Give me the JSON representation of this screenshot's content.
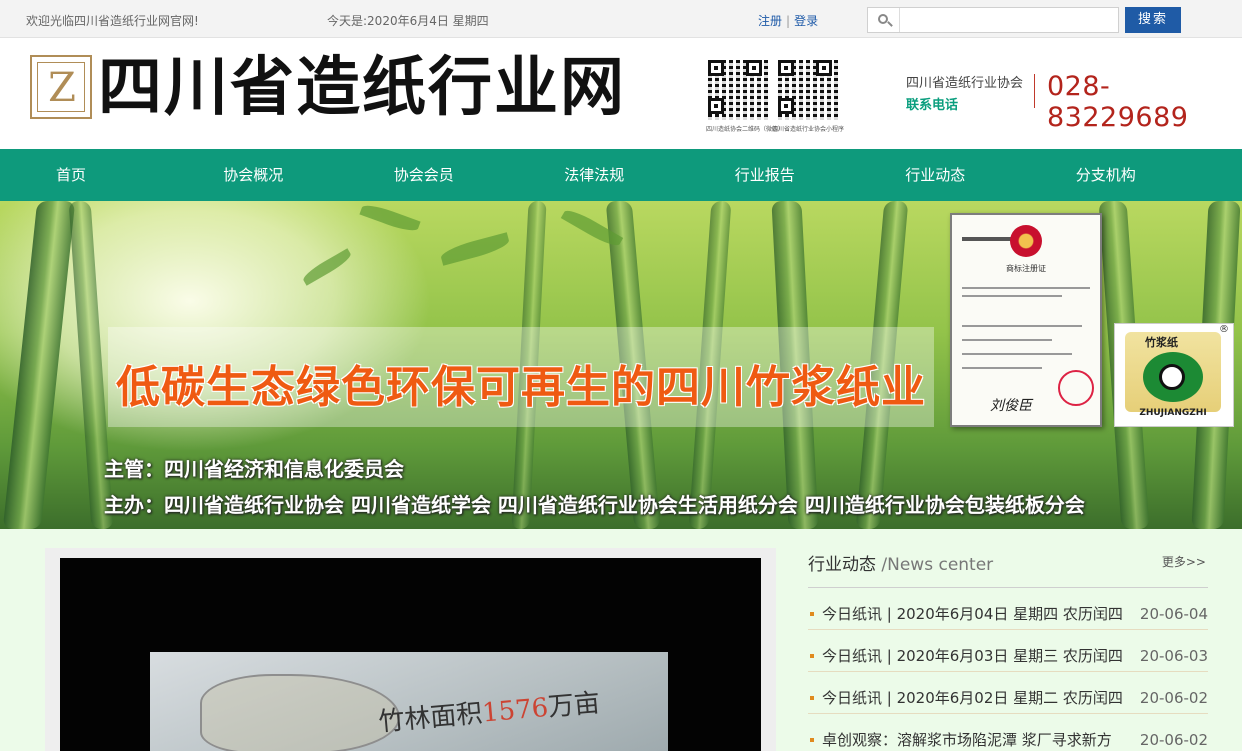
{
  "topbar": {
    "welcome": "欢迎光临四川省造纸行业网官网!",
    "date": "今天是:2020年6月4日 星期四",
    "register": "注册",
    "separator": "|",
    "login": "登录",
    "search_placeholder": "",
    "search_button": "搜索"
  },
  "header": {
    "site_title": "四川省造纸行业网",
    "logo_letter": "Z",
    "qr1_caption": "四川造纸协会二维码（微信）",
    "qr2_caption": "四川省造纸行业协会小程序",
    "association": "四川省造纸行业协会",
    "contact_label": "联系电话",
    "phone": "028-83229689"
  },
  "nav": {
    "items": [
      {
        "label": "首页"
      },
      {
        "label": "协会概况"
      },
      {
        "label": "协会会员"
      },
      {
        "label": "法律法规"
      },
      {
        "label": "行业报告"
      },
      {
        "label": "行业动态"
      },
      {
        "label": "分支机构"
      }
    ]
  },
  "banner": {
    "slogan": "低碳生态绿色环保可再生的四川竹浆纸业",
    "sponsor_line1": "主管：四川省经济和信息化委员会",
    "sponsor_line2": "主办：四川省造纸行业协会 四川省造纸学会 四川省造纸行业协会生活用纸分会 四川造纸行业协会包装纸板分会",
    "certificate_title": "商标注册证",
    "certificate_signature": "刘俊臣",
    "brand_cn": "竹浆纸",
    "brand_en": "ZHUJIANGZHI",
    "brand_reg": "®"
  },
  "video": {
    "overlay_text_prefix": "竹林面积",
    "overlay_number": "1576",
    "overlay_text_suffix": "万亩"
  },
  "news": {
    "title_cn": "行业动态 ",
    "title_en": "/News center",
    "more": "更多>>",
    "items": [
      {
        "title": "今日纸讯 | 2020年6月04日 星期四 农历闰四",
        "date": "20-06-04"
      },
      {
        "title": "今日纸讯 | 2020年6月03日 星期三 农历闰四",
        "date": "20-06-03"
      },
      {
        "title": "今日纸讯 | 2020年6月02日 星期二 农历闰四",
        "date": "20-06-02"
      },
      {
        "title": "卓创观察：溶解浆市场陷泥潭 浆厂寻求新方",
        "date": "20-06-02"
      }
    ]
  },
  "colors": {
    "nav_green": "#0e9a7c",
    "phone_red": "#b3241c",
    "slogan_orange": "#ef5a12",
    "search_blue": "#1f5ba6"
  }
}
